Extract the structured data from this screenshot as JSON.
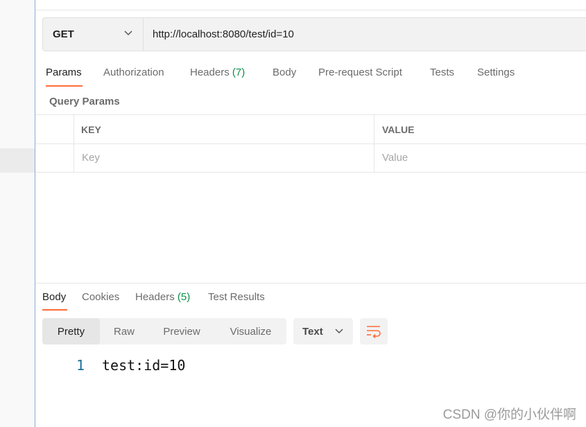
{
  "request": {
    "method": "GET",
    "url": "http://localhost:8080/test/id=10"
  },
  "request_tabs": [
    {
      "label": "Params",
      "active": true
    },
    {
      "label": "Authorization"
    },
    {
      "label": "Headers",
      "count": "(7)"
    },
    {
      "label": "Body"
    },
    {
      "label": "Pre-request Script"
    },
    {
      "label": "Tests"
    },
    {
      "label": "Settings"
    }
  ],
  "query_params": {
    "title": "Query Params",
    "columns": [
      "KEY",
      "VALUE"
    ],
    "placeholders": {
      "key": "Key",
      "value": "Value"
    }
  },
  "response_tabs": [
    {
      "label": "Body",
      "active": true
    },
    {
      "label": "Cookies"
    },
    {
      "label": "Headers",
      "count": "(5)"
    },
    {
      "label": "Test Results"
    }
  ],
  "view_modes": [
    "Pretty",
    "Raw",
    "Preview",
    "Visualize"
  ],
  "active_view_mode": "Pretty",
  "format": "Text",
  "response_body": [
    {
      "line": "1",
      "text": "test:id=10"
    }
  ],
  "watermark": "CSDN @你的小伙伴啊",
  "colors": {
    "accent": "#ff6c37",
    "count_green": "#0c8e49",
    "line_number": "#1a6f9a"
  },
  "icons": {
    "method_dropdown": "chevron-down-icon",
    "format_dropdown": "chevron-down-icon",
    "wrap": "wrap-lines-icon"
  }
}
